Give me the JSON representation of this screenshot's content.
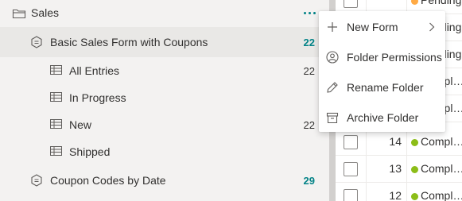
{
  "tree": {
    "folder": {
      "label": "Sales",
      "icon": "folder-icon",
      "more_icon": "ellipsis-icon"
    },
    "items": [
      {
        "label": "Basic Sales Form with Coupons",
        "count": "22",
        "icon": "form-icon",
        "level": 1,
        "accent_count": true
      },
      {
        "label": "All Entries",
        "count": "22",
        "icon": "table-view-icon",
        "level": 2,
        "accent_count": false
      },
      {
        "label": "In Progress",
        "count": "",
        "icon": "table-view-icon",
        "level": 2,
        "accent_count": false
      },
      {
        "label": "New",
        "count": "22",
        "icon": "table-view-icon",
        "level": 2,
        "accent_count": false
      },
      {
        "label": "Shipped",
        "count": "",
        "icon": "table-view-icon",
        "level": 2,
        "accent_count": false
      },
      {
        "label": "Coupon Codes by Date",
        "count": "29",
        "icon": "form-icon",
        "level": 1,
        "accent_count": true
      }
    ]
  },
  "grid": {
    "rows": [
      {
        "number": "",
        "status": "Pending",
        "status_color": "#ffaa44"
      },
      {
        "number": "",
        "status": "Pending",
        "status_color": "#ffaa44"
      },
      {
        "number": "",
        "status": "Pending",
        "status_color": "#ffaa44"
      },
      {
        "number": "",
        "status": "Compl…",
        "status_color": "#8cbd18"
      },
      {
        "number": "",
        "status": "Compl…",
        "status_color": "#8cbd18"
      },
      {
        "number": "14",
        "status": "Compl…",
        "status_color": "#8cbd18"
      },
      {
        "number": "13",
        "status": "Compl…",
        "status_color": "#8cbd18"
      },
      {
        "number": "12",
        "status": "Compl…",
        "status_color": "#8cbd18"
      }
    ]
  },
  "menu": {
    "items": [
      {
        "label": "New Form",
        "icon": "plus-icon",
        "has_submenu": true
      },
      {
        "label": "Folder Permissions",
        "icon": "user-permissions-icon",
        "has_submenu": false
      },
      {
        "label": "Rename Folder",
        "icon": "pencil-icon",
        "has_submenu": false
      },
      {
        "label": "Archive Folder",
        "icon": "archive-icon",
        "has_submenu": false
      }
    ]
  },
  "colors": {
    "accent": "#038387",
    "pending": "#ffaa44",
    "complete": "#8cbd18"
  }
}
